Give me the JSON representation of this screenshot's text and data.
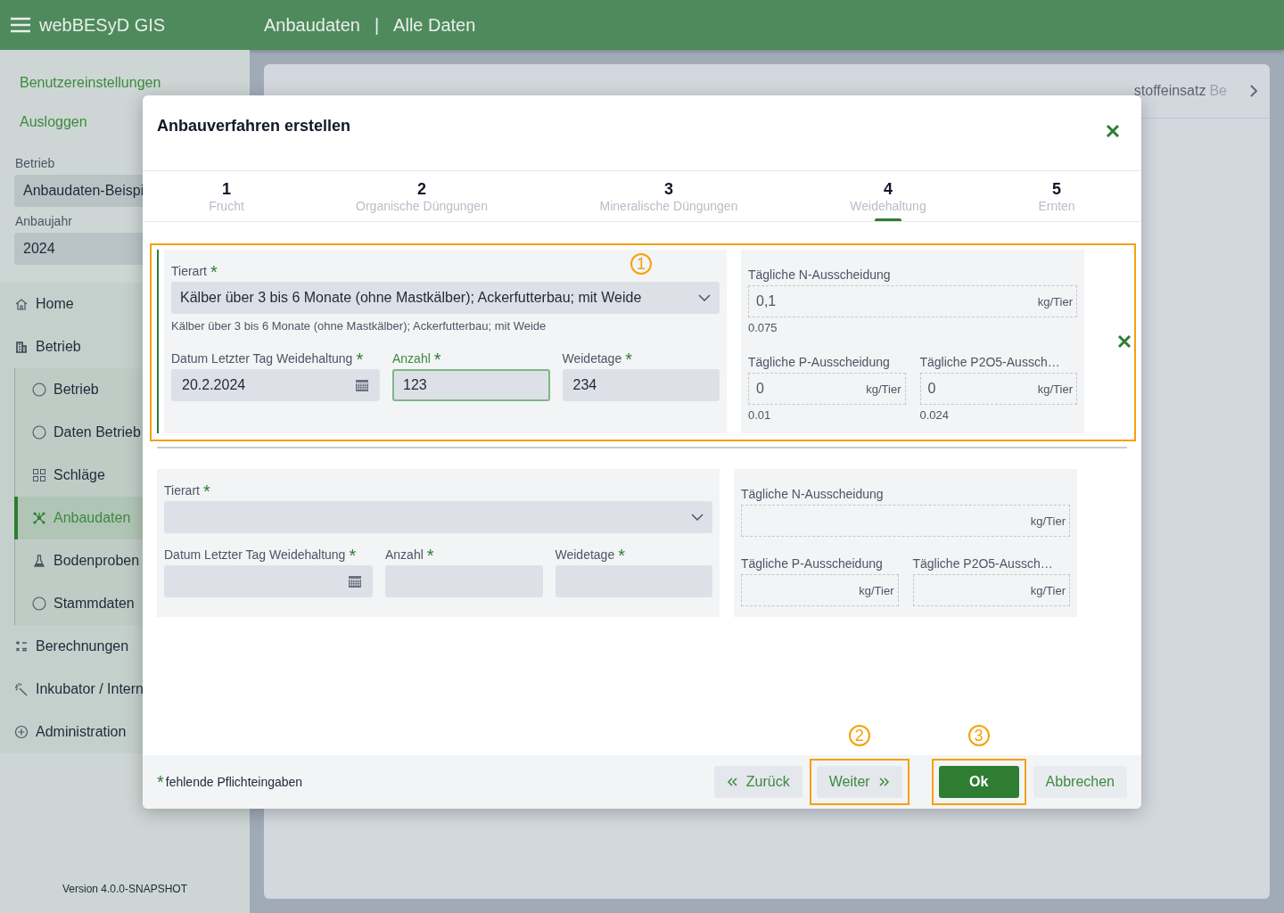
{
  "topbar": {
    "app_title": "webBESyD GIS",
    "breadcrumb": [
      "Anbaudaten",
      "Alle Daten"
    ],
    "separator": "|"
  },
  "sidebar": {
    "links": [
      "Benutzereinstellungen",
      "Ausloggen"
    ],
    "fields": [
      {
        "label": "Betrieb",
        "value": "Anbaudaten-Beispi"
      },
      {
        "label": "Anbaujahr",
        "value": "2024"
      }
    ],
    "nav": [
      {
        "label": "Home"
      },
      {
        "label": "Betrieb",
        "expanded": true,
        "children": [
          {
            "label": "Betrieb",
            "selected": false
          },
          {
            "label": "Daten Betrieb",
            "selected": false
          },
          {
            "label": "Schläge",
            "selected": false
          },
          {
            "label": "Anbaudaten",
            "selected": true
          },
          {
            "label": "Bodenproben",
            "selected": false
          },
          {
            "label": "Stammdaten",
            "selected": false
          }
        ]
      },
      {
        "label": "Berechnungen"
      },
      {
        "label": "Inkubator / Intern"
      },
      {
        "label": "Administration"
      }
    ],
    "version": "Version 4.0.0-SNAPSHOT"
  },
  "background_card": {
    "tabs": [
      "stoffeinsatz",
      "Be"
    ]
  },
  "dialog": {
    "title": "Anbauverfahren erstellen",
    "steps": [
      {
        "number": "1",
        "label": "Frucht",
        "selected": false
      },
      {
        "number": "2",
        "label": "Organische Düngungen",
        "selected": false
      },
      {
        "number": "3",
        "label": "Mineralische Düngungen",
        "selected": false
      },
      {
        "number": "4",
        "label": "Weidehaltung",
        "selected": true
      },
      {
        "number": "5",
        "label": "Ernten",
        "selected": false
      }
    ],
    "rows": [
      {
        "active": true,
        "removable": true,
        "annotation": "1",
        "tierart": {
          "label": "Tierart",
          "mark": "*",
          "value": "Kälber über 3 bis 6 Monate (ohne Mastkälber); Ackerfutterbau; mit Weide",
          "hint": "Kälber über 3 bis 6 Monate (ohne Mastkälber); Ackerfutterbau; mit Weide"
        },
        "fields": [
          {
            "kind": "date",
            "label": "Datum Letzter Tag Weidehaltung",
            "mark": "*",
            "value": "20.2.2024",
            "focused": false
          },
          {
            "kind": "number",
            "label": "Anzahl",
            "mark": "*",
            "value": "123",
            "focused": true
          },
          {
            "kind": "number",
            "label": "Weidetage",
            "mark": "*",
            "value": "234",
            "focused": false
          }
        ],
        "readouts": [
          {
            "label": "Tägliche N-Ausscheidung",
            "value": "0,1",
            "unit": "kg/Tier",
            "hint": "0.075"
          },
          {
            "label": "Tägliche P-Ausscheidung",
            "value": "0",
            "unit": "kg/Tier",
            "hint": "0.01"
          },
          {
            "label": "Tägliche P2O5-Aussch…",
            "value": "0",
            "unit": "kg/Tier",
            "hint": "0.024"
          }
        ]
      },
      {
        "active": false,
        "removable": false,
        "tierart": {
          "label": "Tierart",
          "mark": "*"
        },
        "fields": [
          {
            "kind": "date",
            "label": "Datum Letzter Tag Weidehaltung",
            "mark": "*",
            "focused": false
          },
          {
            "kind": "number",
            "label": "Anzahl",
            "mark": "*",
            "focused": false
          },
          {
            "kind": "number",
            "label": "Weidetage",
            "mark": "*",
            "focused": false
          }
        ],
        "readouts": [
          {
            "label": "Tägliche N-Ausscheidung",
            "unit": "kg/Tier"
          },
          {
            "label": "Tägliche P-Ausscheidung",
            "unit": "kg/Tier"
          },
          {
            "label": "Tägliche P2O5-Aussch…",
            "unit": "kg/Tier"
          }
        ]
      }
    ],
    "legend": {
      "mark": "*",
      "text": "fehlende Pflichteingaben"
    },
    "buttons": [
      {
        "kind": "back",
        "label": "Zurück"
      },
      {
        "kind": "next",
        "label": "Weiter",
        "annotation": "2"
      },
      {
        "kind": "primary",
        "label": "Ok",
        "annotation": "3"
      },
      {
        "kind": "plain",
        "label": "Abbrechen"
      }
    ]
  }
}
